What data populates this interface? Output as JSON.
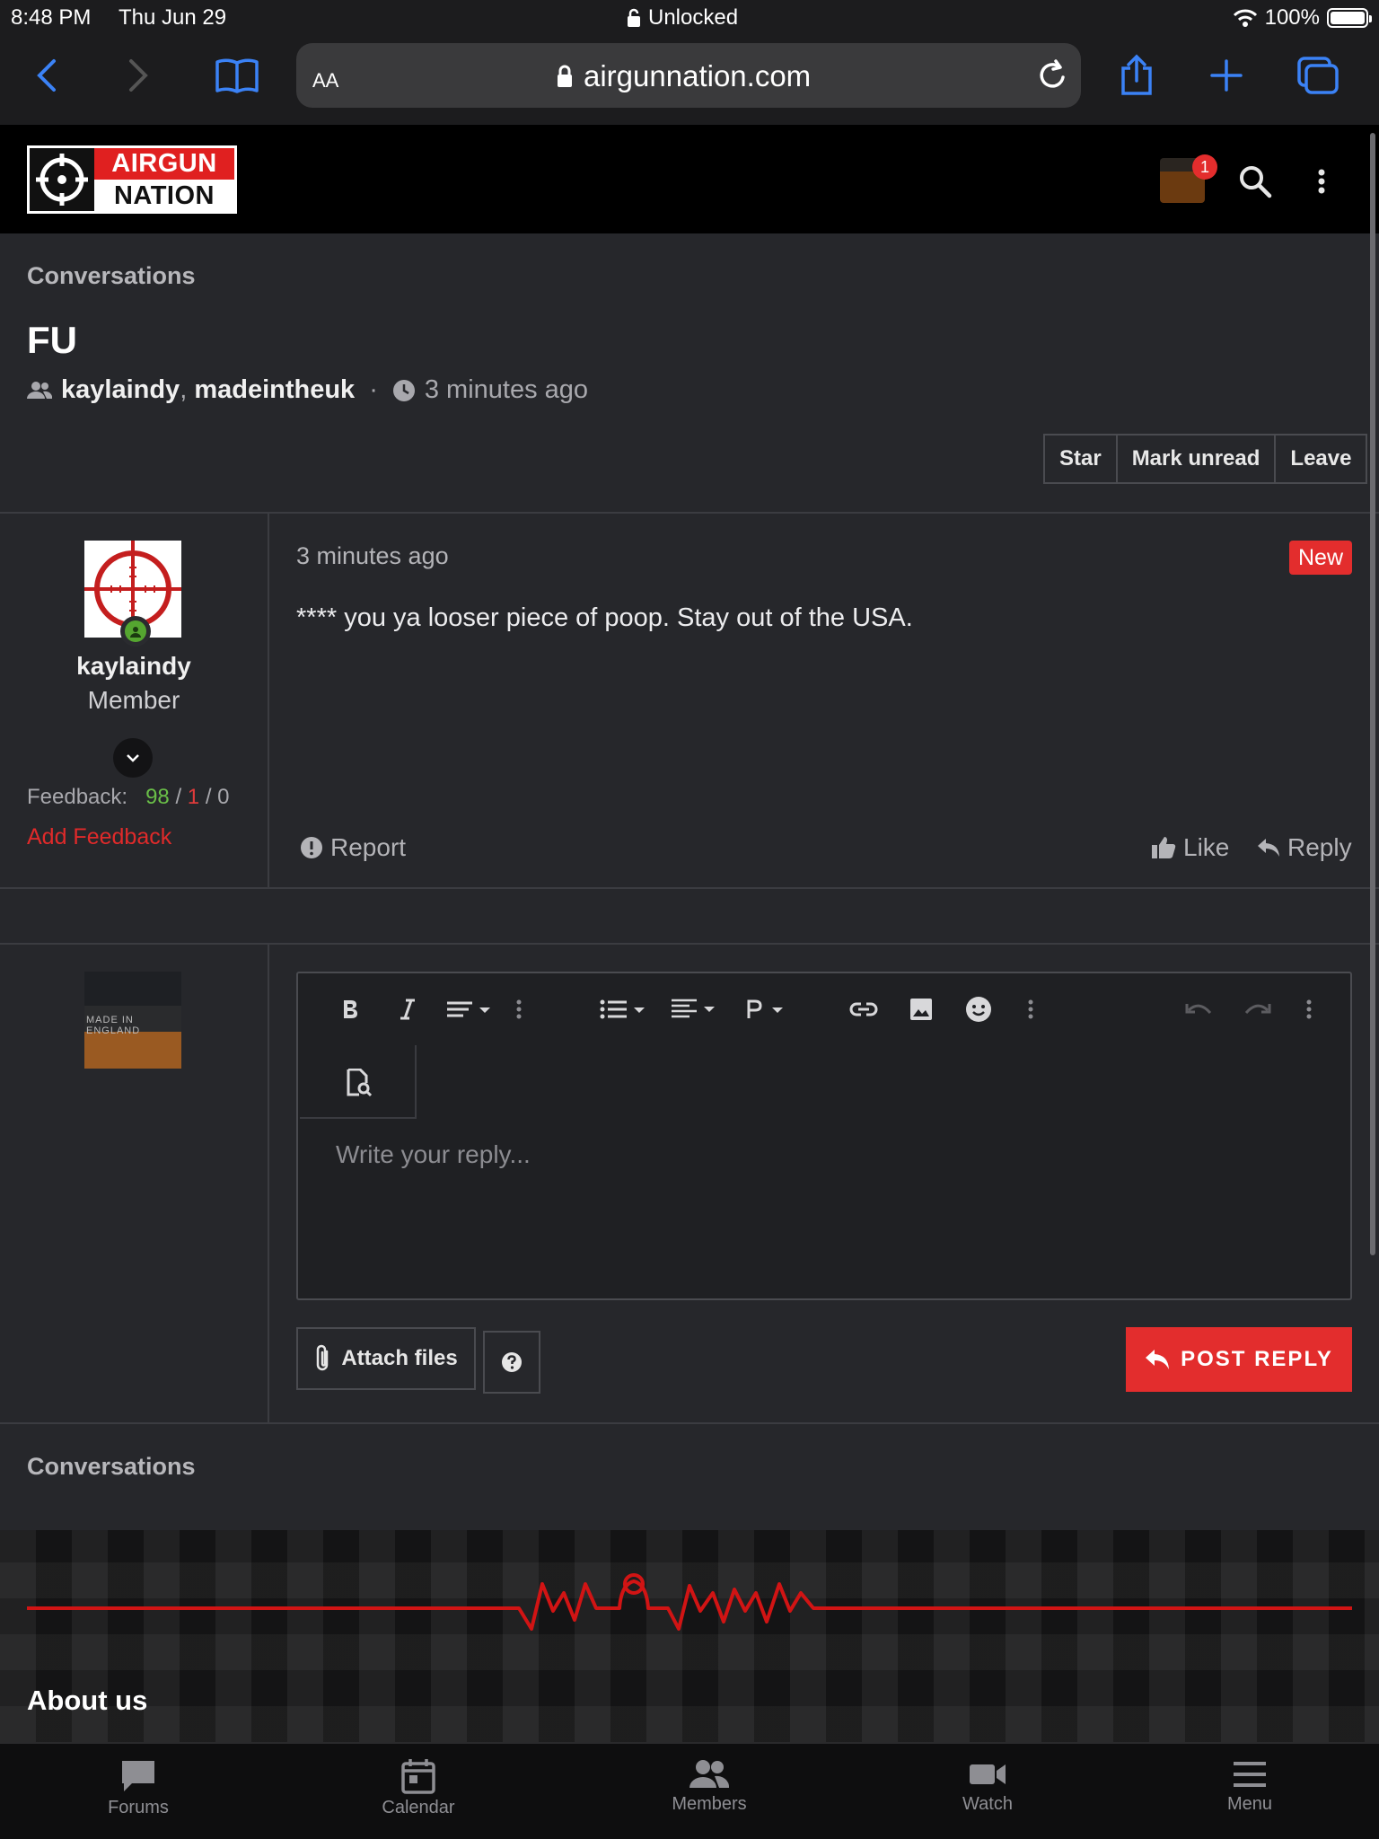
{
  "status_bar": {
    "time": "8:48 PM",
    "date": "Thu Jun 29",
    "lock_text": "Unlocked",
    "battery": "100%"
  },
  "browser": {
    "aa": "AA",
    "url": "airgunnation.com"
  },
  "site": {
    "logo_top": "AIRGUN",
    "logo_bottom": "NATION",
    "notification_count": "1"
  },
  "page": {
    "breadcrumb": "Conversations",
    "title": "FU",
    "participants": [
      "kaylaindy",
      "madeintheuk"
    ],
    "time": "3 minutes ago",
    "actions": {
      "star": "Star",
      "mark_unread": "Mark unread",
      "leave": "Leave"
    }
  },
  "message": {
    "author": "kaylaindy",
    "role": "Member",
    "feedback_label": "Feedback:",
    "feedback_pos": "98",
    "feedback_neg": "1",
    "feedback_neutral": "0",
    "add_feedback": "Add Feedback",
    "time": "3 minutes ago",
    "badge": "New",
    "body": "**** you ya looser piece of poop. Stay out of the USA.",
    "report": "Report",
    "like": "Like",
    "reply": "Reply"
  },
  "reply_form": {
    "avatar_text": "MADE IN ENGLAND",
    "placeholder": "Write your reply...",
    "attach": "Attach files",
    "submit": "POST REPLY"
  },
  "footer": {
    "breadcrumb": "Conversations",
    "about": "About us"
  },
  "tabbar": [
    {
      "label": "Forums",
      "icon": "forums-icon"
    },
    {
      "label": "Calendar",
      "icon": "calendar-icon"
    },
    {
      "label": "Members",
      "icon": "members-icon"
    },
    {
      "label": "Watch",
      "icon": "watch-icon"
    },
    {
      "label": "Menu",
      "icon": "menu-icon"
    }
  ],
  "colors": {
    "accent": "#e32d2d",
    "background": "#26272b",
    "header": "#000000",
    "positive": "#6abf48"
  }
}
